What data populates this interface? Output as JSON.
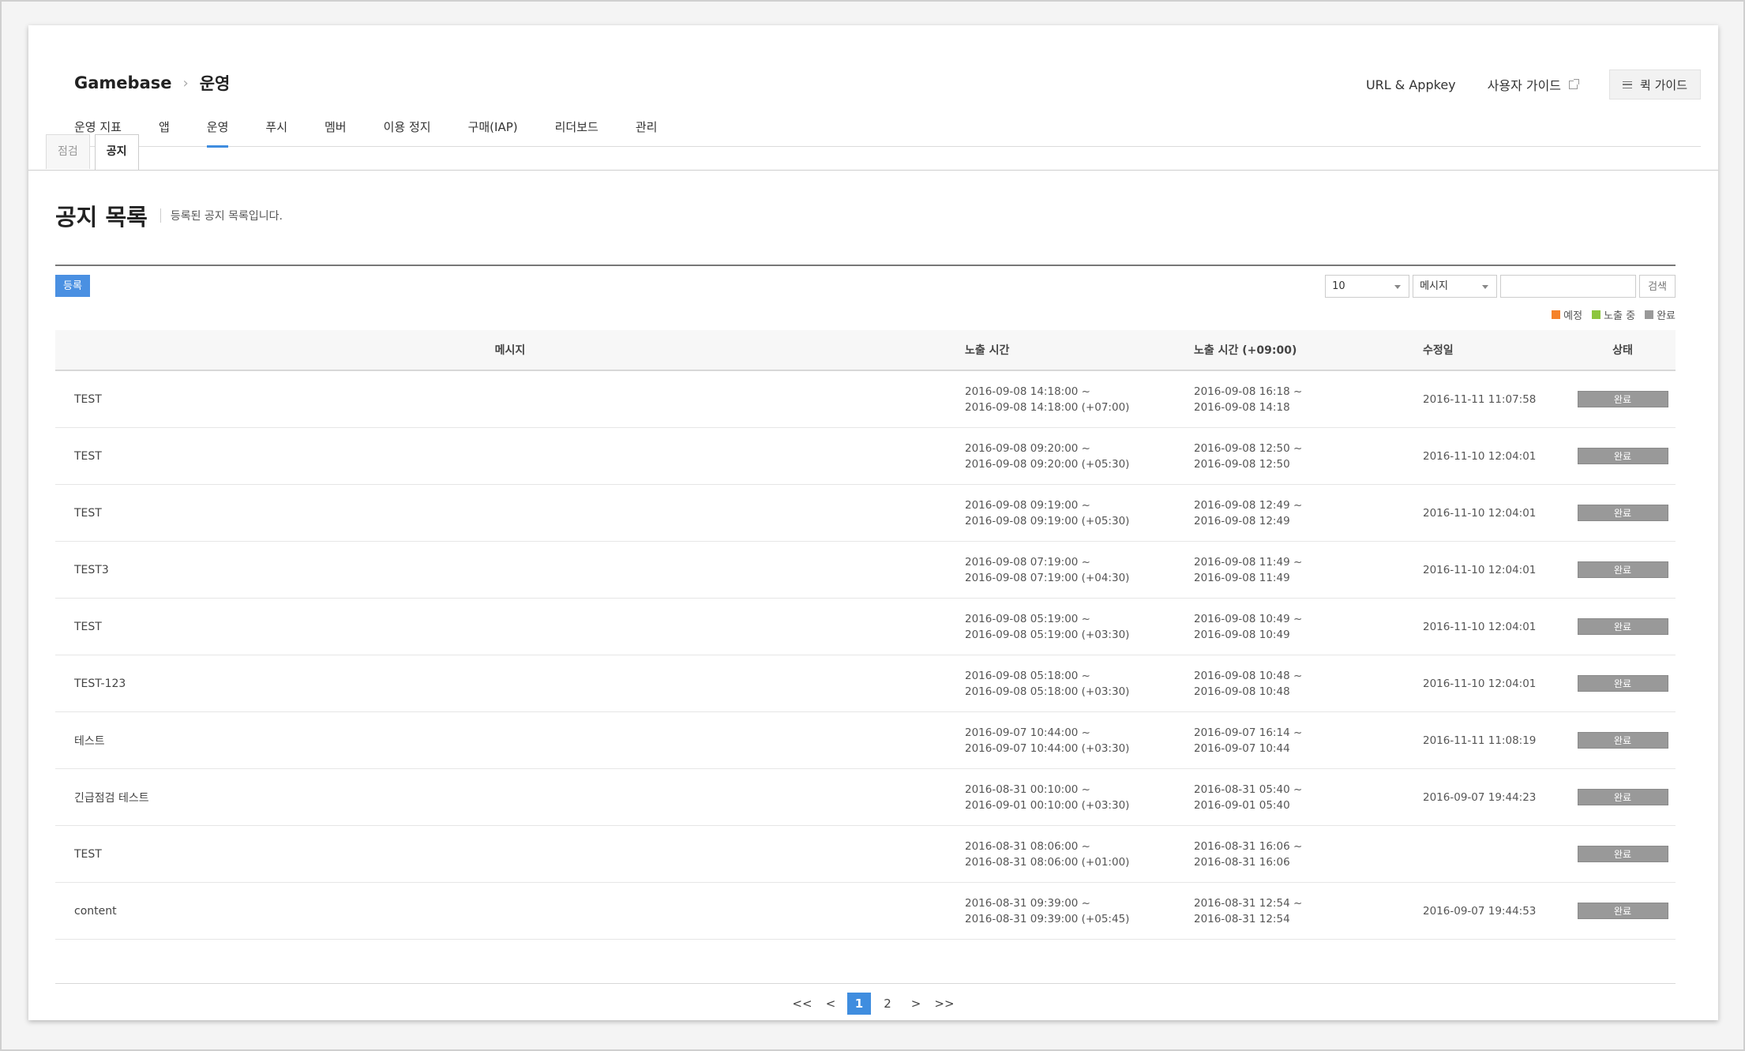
{
  "header": {
    "brand": "Gamebase",
    "section": "운영",
    "links": {
      "url_appkey": "URL & Appkey",
      "user_guide": "사용자 가이드",
      "quick_guide": "퀵 가이드"
    }
  },
  "main_nav": [
    {
      "label": "운영 지표",
      "active": false
    },
    {
      "label": "앱",
      "active": false
    },
    {
      "label": "운영",
      "active": true
    },
    {
      "label": "푸시",
      "active": false
    },
    {
      "label": "멤버",
      "active": false
    },
    {
      "label": "이용 정지",
      "active": false
    },
    {
      "label": "구매(IAP)",
      "active": false
    },
    {
      "label": "리더보드",
      "active": false
    },
    {
      "label": "관리",
      "active": false
    }
  ],
  "sub_tabs": {
    "maintenance": "점검",
    "notice": "공지"
  },
  "page": {
    "title": "공지 목록",
    "description": "등록된 공지 목록입니다."
  },
  "toolbar": {
    "register": "등록",
    "page_size": "10",
    "search_type": "메시지",
    "search_value": "",
    "search_button": "검색"
  },
  "legend": {
    "scheduled": {
      "label": "예정",
      "color": "#f5822a"
    },
    "showing": {
      "label": "노출 중",
      "color": "#8dc63f"
    },
    "done": {
      "label": "완료",
      "color": "#999999"
    }
  },
  "table": {
    "headers": {
      "message": "메시지",
      "time": "노출 시간",
      "time_local": "노출 시간 (+09:00)",
      "modified": "수정일",
      "status": "상태"
    },
    "rows": [
      {
        "message": "TEST",
        "time1": "2016-09-08 14:18:00 ~",
        "time2": "2016-09-08 14:18:00 (+07:00)",
        "local1": "2016-09-08 16:18 ~",
        "local2": "2016-09-08 14:18",
        "modified": "2016-11-11 11:07:58",
        "status": "완료"
      },
      {
        "message": "TEST",
        "time1": "2016-09-08 09:20:00 ~",
        "time2": "2016-09-08 09:20:00 (+05:30)",
        "local1": "2016-09-08 12:50 ~",
        "local2": "2016-09-08 12:50",
        "modified": "2016-11-10 12:04:01",
        "status": "완료"
      },
      {
        "message": "TEST",
        "time1": "2016-09-08 09:19:00 ~",
        "time2": "2016-09-08 09:19:00 (+05:30)",
        "local1": "2016-09-08 12:49 ~",
        "local2": "2016-09-08 12:49",
        "modified": "2016-11-10 12:04:01",
        "status": "완료"
      },
      {
        "message": "TEST3",
        "time1": "2016-09-08 07:19:00 ~",
        "time2": "2016-09-08 07:19:00 (+04:30)",
        "local1": "2016-09-08 11:49 ~",
        "local2": "2016-09-08 11:49",
        "modified": "2016-11-10 12:04:01",
        "status": "완료"
      },
      {
        "message": "TEST",
        "time1": "2016-09-08 05:19:00 ~",
        "time2": "2016-09-08 05:19:00 (+03:30)",
        "local1": "2016-09-08 10:49 ~",
        "local2": "2016-09-08 10:49",
        "modified": "2016-11-10 12:04:01",
        "status": "완료"
      },
      {
        "message": "TEST-123",
        "time1": "2016-09-08 05:18:00 ~",
        "time2": "2016-09-08 05:18:00 (+03:30)",
        "local1": "2016-09-08 10:48 ~",
        "local2": "2016-09-08 10:48",
        "modified": "2016-11-10 12:04:01",
        "status": "완료"
      },
      {
        "message": "테스트",
        "time1": "2016-09-07 10:44:00 ~",
        "time2": "2016-09-07 10:44:00 (+03:30)",
        "local1": "2016-09-07 16:14 ~",
        "local2": "2016-09-07 10:44",
        "modified": "2016-11-11 11:08:19",
        "status": "완료"
      },
      {
        "message": "긴급점검 테스트",
        "time1": "2016-08-31 00:10:00 ~",
        "time2": "2016-09-01 00:10:00 (+03:30)",
        "local1": "2016-08-31 05:40 ~",
        "local2": "2016-09-01 05:40",
        "modified": "2016-09-07 19:44:23",
        "status": "완료"
      },
      {
        "message": "TEST",
        "time1": "2016-08-31 08:06:00 ~",
        "time2": "2016-08-31 08:06:00 (+01:00)",
        "local1": "2016-08-31 16:06 ~",
        "local2": "2016-08-31 16:06",
        "modified": "",
        "status": "완료"
      },
      {
        "message": "content",
        "time1": "2016-08-31 09:39:00 ~",
        "time2": "2016-08-31 09:39:00 (+05:45)",
        "local1": "2016-08-31 12:54 ~",
        "local2": "2016-08-31 12:54",
        "modified": "2016-09-07 19:44:53",
        "status": "완료"
      }
    ]
  },
  "pagination": {
    "first": "<<",
    "prev": "<",
    "pages": [
      "1",
      "2"
    ],
    "current": "1",
    "next": ">",
    "last": ">>"
  }
}
